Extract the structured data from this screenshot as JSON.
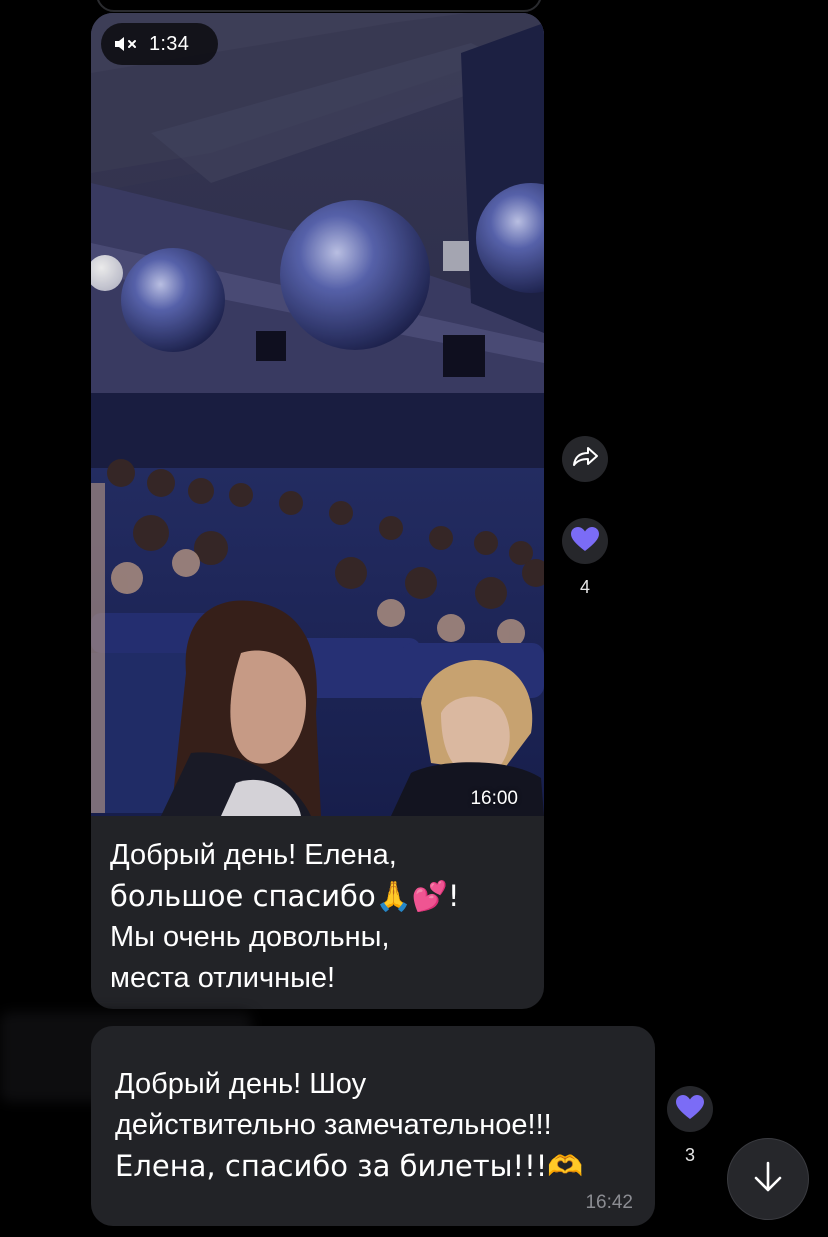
{
  "colors": {
    "background": "#000000",
    "bubble": "#222327",
    "reaction_heart": "#7b6cf6",
    "timestamp": "#8b8c92",
    "action_button": "#26272b"
  },
  "message1": {
    "video": {
      "mute_icon": "speaker-muted-icon",
      "duration": "1:34",
      "time": "16:00"
    },
    "caption_lines": [
      "Добрый день! Елена,",
      "большое спасибо🙏💕!",
      "Мы очень довольны,",
      "места отличные!"
    ],
    "share_icon": "share-arrow-icon",
    "reaction": {
      "icon": "purple-heart-icon",
      "count": "4"
    }
  },
  "message2": {
    "caption_lines": [
      "Добрый день! Шоу",
      "действительно замечательное!!!",
      "Елена, спасибо за билеты!!!🫶"
    ],
    "time": "16:42",
    "reaction": {
      "icon": "purple-heart-icon",
      "count": "3"
    }
  },
  "scroll_down_icon": "arrow-down-icon"
}
